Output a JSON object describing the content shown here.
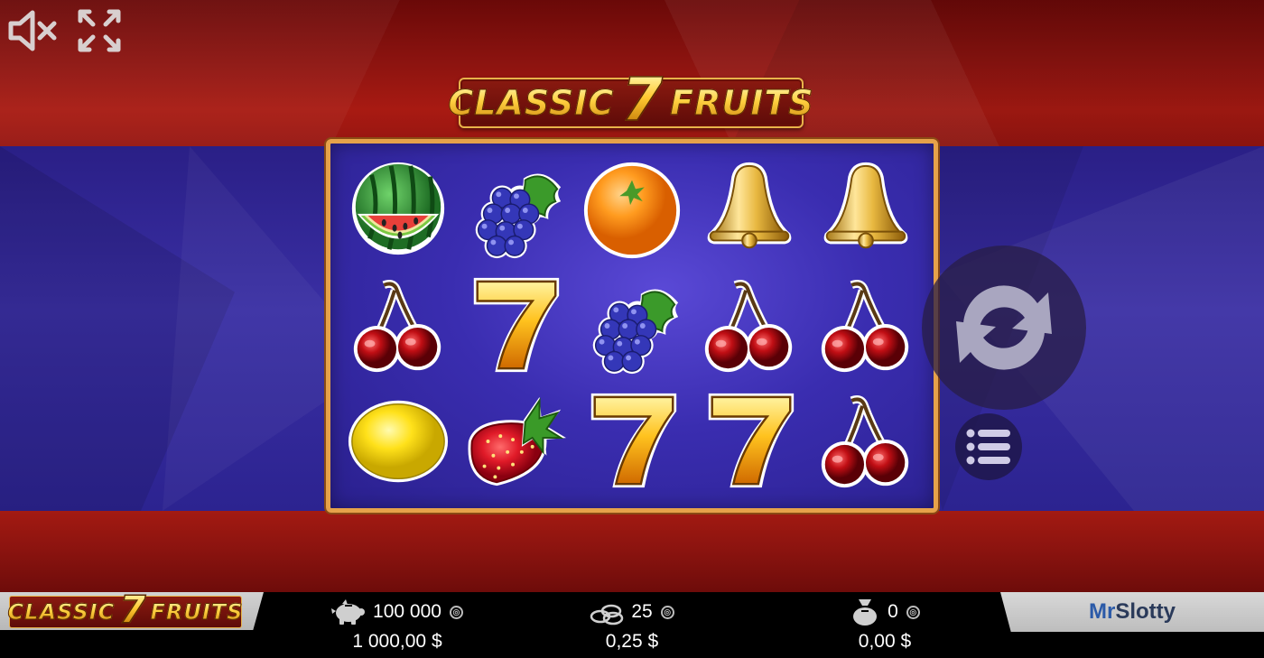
{
  "game": {
    "title_word1": "CLASSIC",
    "title_seven": "7",
    "title_word2": "FRUITS"
  },
  "controls": {
    "mute_icon": "speaker-muted-icon",
    "fullscreen_icon": "fullscreen-expand-icon",
    "spin_icon": "spin-arrows-icon",
    "menu_icon": "menu-list-icon"
  },
  "reels": [
    [
      "watermelon",
      "grapes",
      "orange",
      "bell",
      "bell"
    ],
    [
      "cherries",
      "seven",
      "grapes",
      "cherries",
      "cherries"
    ],
    [
      "lemon",
      "strawberry",
      "seven",
      "seven",
      "cherries"
    ]
  ],
  "footer": {
    "balance_coins": "100 000",
    "balance_money": "1 000,00 $",
    "bet_coins": "25",
    "bet_money": "0,25 $",
    "win_coins": "0",
    "win_money": "0,00 $",
    "coin_icon": "coin-icon",
    "brand_mr": "Mr",
    "brand_slotty": "Slotty"
  },
  "colors": {
    "frame": "#e6a24a",
    "reel_bg": "#3a2db0",
    "band_red": "#8e1410",
    "band_blue": "#2a1f86"
  }
}
